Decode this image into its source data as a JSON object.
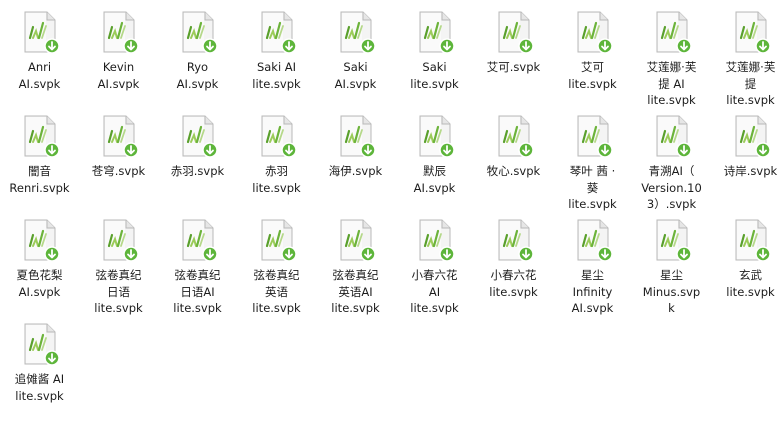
{
  "icon": {
    "name": "svpk-file-icon",
    "accent": "#76b82a",
    "badge": "#5fb531",
    "paper": "#f3f3f3",
    "border": "#b9b9b9"
  },
  "files": [
    "Anri\nAI.svpk",
    "Kevin\nAI.svpk",
    "Ryo\nAI.svpk",
    "Saki AI\nlite.svpk",
    "Saki\nAI.svpk",
    "Saki\nlite.svpk",
    "艾可.svpk",
    "艾可\nlite.svpk",
    "艾莲娜·芙\n提 AI\nlite.svpk",
    "艾莲娜·芙\n提\nlite.svpk",
    "闇音\nRenri.svpk",
    "苍穹.svpk",
    "赤羽.svpk",
    "赤羽\nlite.svpk",
    "海伊.svpk",
    "默辰\nAI.svpk",
    "牧心.svpk",
    "琴叶 茜 ·\n葵\nlite.svpk",
    "青溯AI（\nVersion.10\n3）.svpk",
    "诗岸.svpk",
    "夏色花梨\nAI.svpk",
    "弦卷真纪\n日语\nlite.svpk",
    "弦卷真纪\n日语AI\nlite.svpk",
    "弦卷真纪\n英语\nlite.svpk",
    "弦卷真纪\n英语AI\nlite.svpk",
    "小春六花\nAI\nlite.svpk",
    "小春六花\nlite.svpk",
    "星尘\nInfinity\nAI.svpk",
    "星尘\nMinus.svp\nk",
    "玄武\nlite.svpk",
    "追傩酱 AI\nlite.svpk"
  ]
}
